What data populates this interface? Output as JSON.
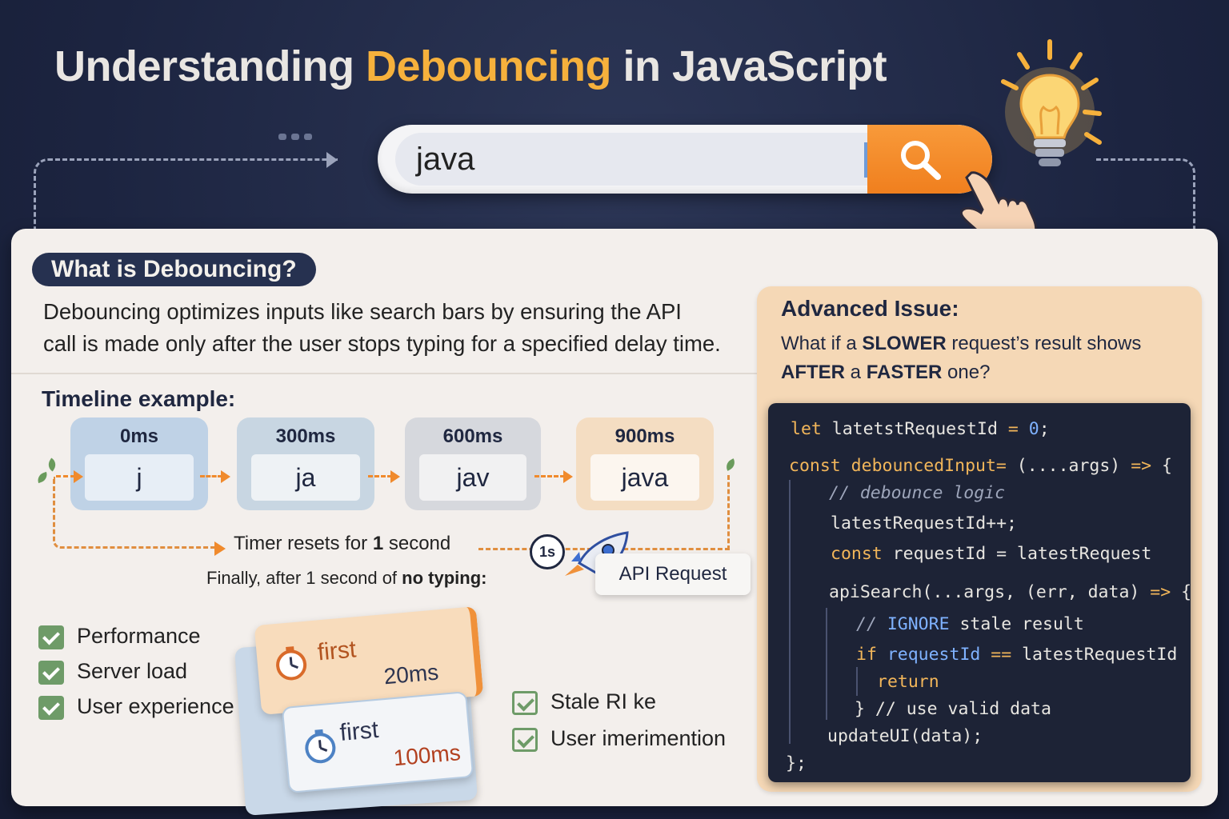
{
  "title": {
    "part1": "Understanding ",
    "accent": "Debouncing",
    "part2": " in JavaScript"
  },
  "colors": {
    "accent": "#f6b13c",
    "search_button": "#f07f1e",
    "background": "#1c2440",
    "panel": "#f3efec",
    "advanced_panel": "#f5d8b6",
    "code_bg": "#1d2336"
  },
  "search": {
    "value": "java",
    "button_icon": "search-icon"
  },
  "section": {
    "heading": "What is Debouncing?",
    "intro_line1": "Debouncing optimizes inputs like search bars by ensuring the API",
    "intro_line2": "call is made only after the user stops typing for a specified delay time."
  },
  "timeline": {
    "title": "Timeline example:",
    "steps": [
      {
        "time": "0ms",
        "text": "j"
      },
      {
        "time": "300ms",
        "text": "ja"
      },
      {
        "time": "600ms",
        "text": "jav"
      },
      {
        "time": "900ms",
        "text": "java"
      }
    ],
    "timer_prefix": "Timer resets for ",
    "timer_bold": "1",
    "timer_suffix": " second",
    "clock_label": "1s",
    "finally_prefix": "Finally, after 1 second of ",
    "finally_bold": "no typing:",
    "api_label": "API Request"
  },
  "benefits": [
    "Performance",
    "Server load",
    "User experience"
  ],
  "extra_checks": [
    "Stale RI ke",
    "User imerimention"
  ],
  "cards": [
    {
      "label": "first",
      "time": "20ms"
    },
    {
      "label": "first",
      "time": "100ms"
    }
  ],
  "advanced": {
    "title": "Advanced Issue:",
    "q_prefix": "What if a ",
    "q_bold1": "SLOWER",
    "q_mid": " request’s result shows ",
    "q_bold2": "AFTER",
    "q_mid2": " a ",
    "q_bold3": "FASTER",
    "q_suffix": " one?"
  },
  "code": {
    "l1_kw": "let",
    "l1_var": " latetstRequestId ",
    "l1_op": "=",
    "l1_num": " 0",
    "l1_end": ";",
    "l2_kw": "const",
    "l2_fn": " debouncedInput",
    "l2_op": "=",
    "l2_args": " (....args) ",
    "l2_arrow": "=>",
    "l2_end": " {",
    "l3": "// debounce logic",
    "l4": "latestRequestId++;",
    "l5_kw": "const",
    "l5_rest": " requestId = latestRequest",
    "l6_fn": "apiSearch",
    "l6_rest": "(...args, (err, data) ",
    "l6_arrow": "=>",
    "l6_end": " {",
    "l7_cm": "// ",
    "l7_kw": "IGNORE",
    "l7_rest": " stale result",
    "l8_kw": "if",
    "l8_var": " requestId ",
    "l8_op": "==",
    "l8_rest": " latestRequestId",
    "l9": "return",
    "l10": "} // use valid data",
    "l11": "updateUI(data);",
    "l12": "};"
  }
}
